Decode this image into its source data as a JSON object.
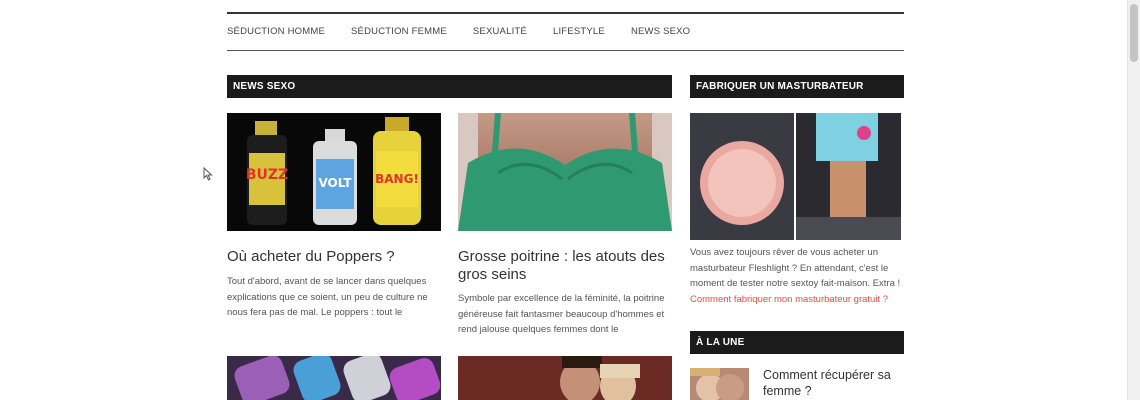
{
  "nav": {
    "items": [
      "SÉDUCTION HOMME",
      "SÉDUCTION FEMME",
      "SEXUALITÉ",
      "LIFESTYLE",
      "NEWS SEXO"
    ]
  },
  "main": {
    "section_title": "NEWS SEXO",
    "articles": [
      {
        "title": "Où acheter du Poppers ?",
        "excerpt": "Tout d'abord, avant de se lancer dans quelques explications que ce soient, un peu de culture ne nous fera pas de mal. Le poppers : tout le",
        "image_labels": [
          "BUZZ",
          "VOLT",
          "BANG!"
        ]
      },
      {
        "title": "Grosse poitrine : les atouts des gros seins",
        "excerpt": "Symbole par excellence de la féminité, la poitrine généreuse fait fantasmer beaucoup d'hommes et rend jalouse quelques femmes dont le"
      }
    ]
  },
  "sidebar": {
    "promo": {
      "title": "FABRIQUER UN MASTURBATEUR MAISON",
      "text": "Vous avez toujours rêver de vous acheter un masturbateur Fleshlight ? En attendant, c'est le moment de tester notre sextoy fait-maison. Extra !",
      "link": "Comment fabriquer mon masturbateur gratuit ?"
    },
    "featured": {
      "title": "À LA UNE",
      "item_title": "Comment récupérer sa femme ?"
    }
  }
}
